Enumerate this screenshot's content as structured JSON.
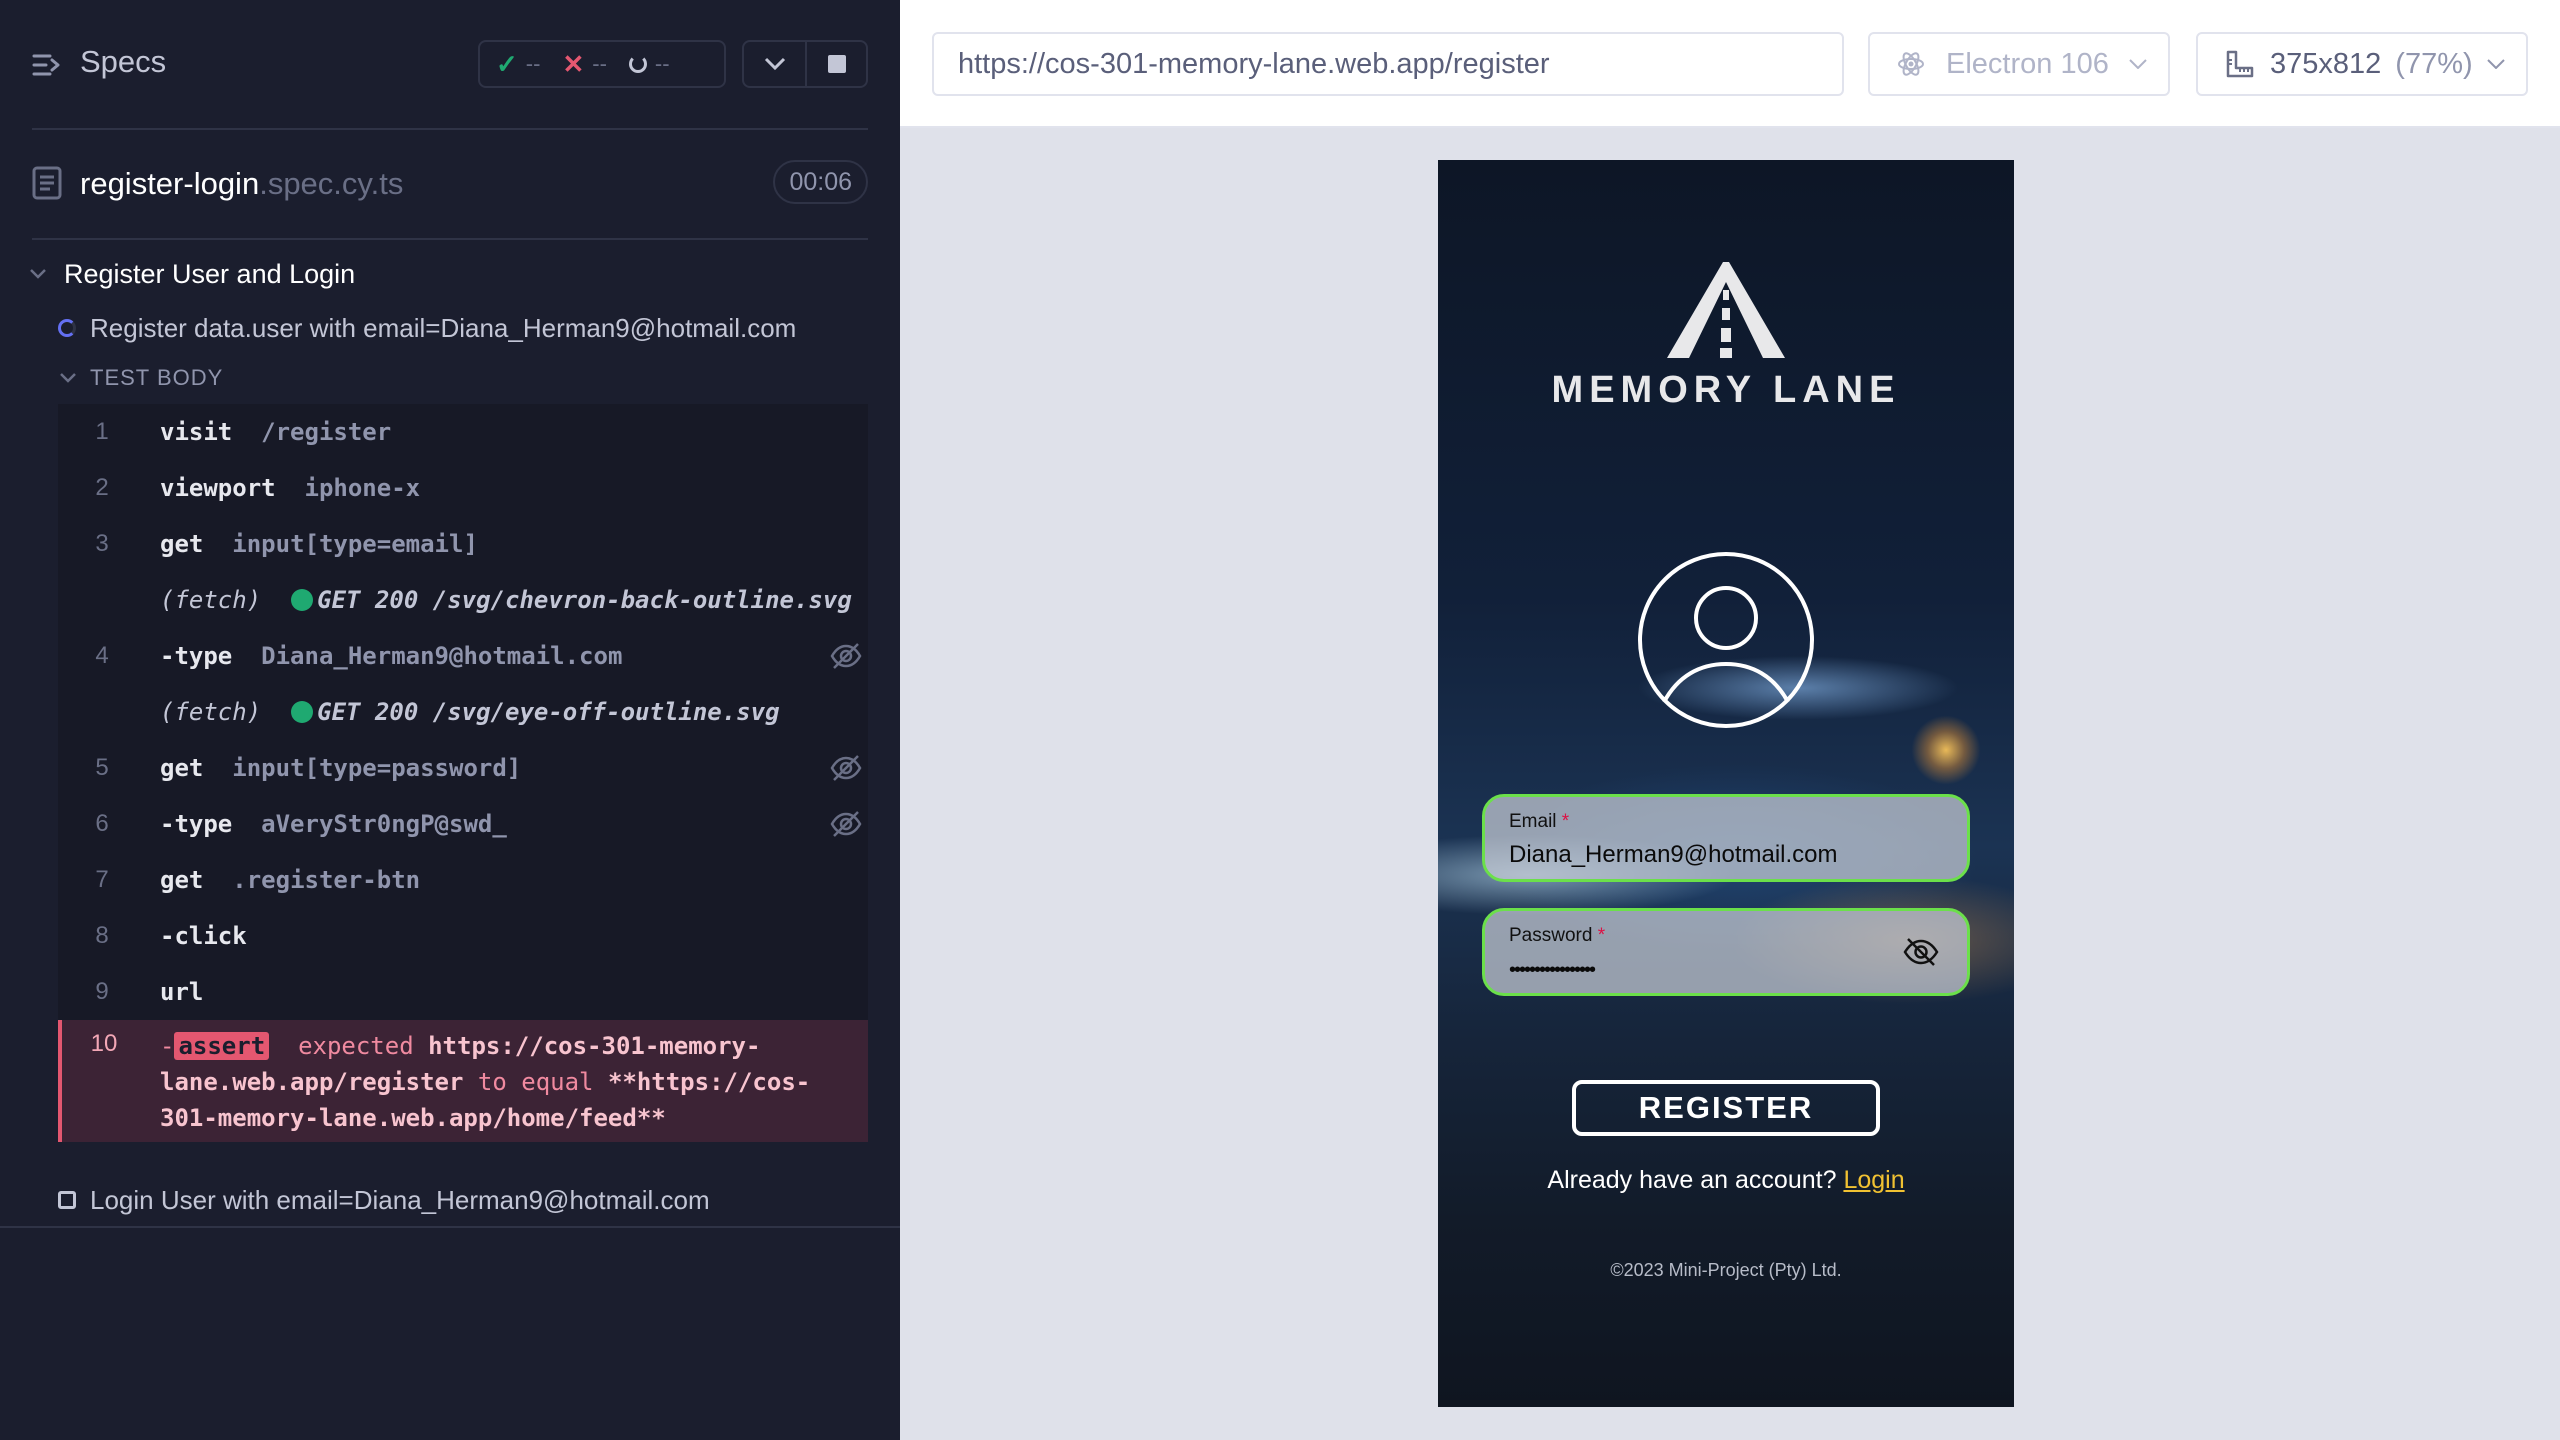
{
  "reporter": {
    "title": "Specs",
    "stats": {
      "passed": "--",
      "failed": "--",
      "pending": "--"
    },
    "file": {
      "name": "register-login",
      "ext": ".spec.cy.ts",
      "duration": "00:06"
    },
    "suite": "Register User and Login",
    "tests": [
      {
        "title": "Register data.user with email=Diana_Herman9@hotmail.com",
        "state": "running"
      },
      {
        "title": "Login User with email=Diana_Herman9@hotmail.com",
        "state": "pending"
      }
    ],
    "section_label": "TEST BODY",
    "commands": [
      {
        "num": "1",
        "name": "visit",
        "msg": "/register"
      },
      {
        "num": "2",
        "name": "viewport",
        "msg": "iphone-x"
      },
      {
        "num": "3",
        "name": "get",
        "msg": "input[type=email]"
      },
      {
        "num": "",
        "name": "(fetch)",
        "msg": "GET 200 /svg/chevron-back-outline.svg"
      },
      {
        "num": "4",
        "name": "-type",
        "msg": "Diana_Herman9@hotmail.com"
      },
      {
        "num": "",
        "name": "(fetch)",
        "msg": "GET 200 /svg/eye-off-outline.svg"
      },
      {
        "num": "5",
        "name": "get",
        "msg": "input[type=password]"
      },
      {
        "num": "6",
        "name": "-type",
        "msg": "aVeryStr0ngP@swd_"
      },
      {
        "num": "7",
        "name": "get",
        "msg": ".register-btn"
      },
      {
        "num": "8",
        "name": "-click",
        "msg": ""
      },
      {
        "num": "9",
        "name": "url",
        "msg": ""
      }
    ],
    "failed_command": {
      "num": "10",
      "dash": "-",
      "badge": "assert",
      "expected": "expected",
      "actual": "https://cos-301-memory-lane.web.app/register",
      "to_equal": "to equal",
      "target": "**https://cos-301-memory-lane.web.app/home/feed**"
    }
  },
  "browser": {
    "url": "https://cos-301-memory-lane.web.app/register",
    "name": "Electron 106",
    "viewport": "375x812",
    "zoom": "(77%)"
  },
  "app": {
    "brand": "MEMORY LANE",
    "email_label": "Email",
    "email_value": "Diana_Herman9@hotmail.com",
    "password_label": "Password",
    "password_value": "•••••••••••••••••",
    "required_mark": "*",
    "register_button": "REGISTER",
    "have_account": "Already have an account?",
    "login_link": "Login",
    "copyright": "©2023 Mini-Project (Pty) Ltd.",
    "colors": {
      "field_border": "#6be04a",
      "link": "#f1c232"
    }
  }
}
